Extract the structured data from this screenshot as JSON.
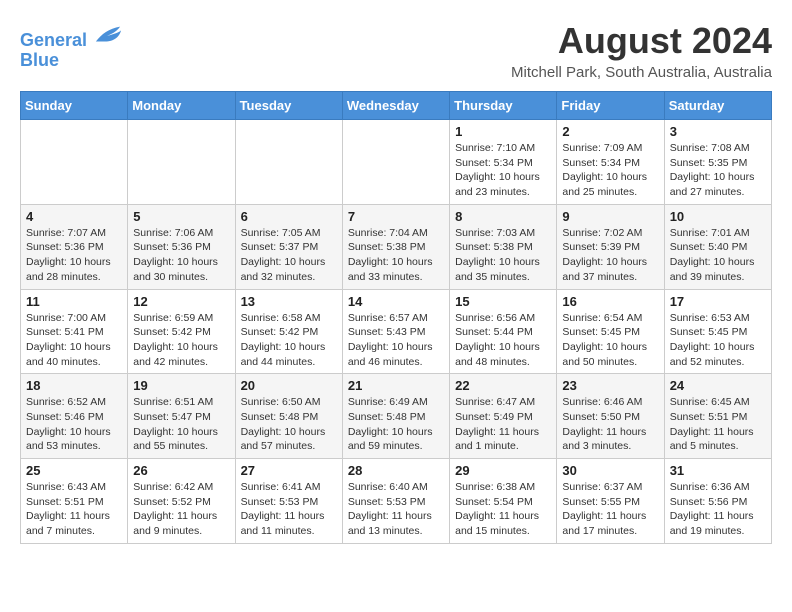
{
  "logo": {
    "line1": "General",
    "line2": "Blue"
  },
  "title": "August 2024",
  "subtitle": "Mitchell Park, South Australia, Australia",
  "days_of_week": [
    "Sunday",
    "Monday",
    "Tuesday",
    "Wednesday",
    "Thursday",
    "Friday",
    "Saturday"
  ],
  "weeks": [
    [
      {
        "day": "",
        "info": ""
      },
      {
        "day": "",
        "info": ""
      },
      {
        "day": "",
        "info": ""
      },
      {
        "day": "",
        "info": ""
      },
      {
        "day": "1",
        "info": "Sunrise: 7:10 AM\nSunset: 5:34 PM\nDaylight: 10 hours\nand 23 minutes."
      },
      {
        "day": "2",
        "info": "Sunrise: 7:09 AM\nSunset: 5:34 PM\nDaylight: 10 hours\nand 25 minutes."
      },
      {
        "day": "3",
        "info": "Sunrise: 7:08 AM\nSunset: 5:35 PM\nDaylight: 10 hours\nand 27 minutes."
      }
    ],
    [
      {
        "day": "4",
        "info": "Sunrise: 7:07 AM\nSunset: 5:36 PM\nDaylight: 10 hours\nand 28 minutes."
      },
      {
        "day": "5",
        "info": "Sunrise: 7:06 AM\nSunset: 5:36 PM\nDaylight: 10 hours\nand 30 minutes."
      },
      {
        "day": "6",
        "info": "Sunrise: 7:05 AM\nSunset: 5:37 PM\nDaylight: 10 hours\nand 32 minutes."
      },
      {
        "day": "7",
        "info": "Sunrise: 7:04 AM\nSunset: 5:38 PM\nDaylight: 10 hours\nand 33 minutes."
      },
      {
        "day": "8",
        "info": "Sunrise: 7:03 AM\nSunset: 5:38 PM\nDaylight: 10 hours\nand 35 minutes."
      },
      {
        "day": "9",
        "info": "Sunrise: 7:02 AM\nSunset: 5:39 PM\nDaylight: 10 hours\nand 37 minutes."
      },
      {
        "day": "10",
        "info": "Sunrise: 7:01 AM\nSunset: 5:40 PM\nDaylight: 10 hours\nand 39 minutes."
      }
    ],
    [
      {
        "day": "11",
        "info": "Sunrise: 7:00 AM\nSunset: 5:41 PM\nDaylight: 10 hours\nand 40 minutes."
      },
      {
        "day": "12",
        "info": "Sunrise: 6:59 AM\nSunset: 5:42 PM\nDaylight: 10 hours\nand 42 minutes."
      },
      {
        "day": "13",
        "info": "Sunrise: 6:58 AM\nSunset: 5:42 PM\nDaylight: 10 hours\nand 44 minutes."
      },
      {
        "day": "14",
        "info": "Sunrise: 6:57 AM\nSunset: 5:43 PM\nDaylight: 10 hours\nand 46 minutes."
      },
      {
        "day": "15",
        "info": "Sunrise: 6:56 AM\nSunset: 5:44 PM\nDaylight: 10 hours\nand 48 minutes."
      },
      {
        "day": "16",
        "info": "Sunrise: 6:54 AM\nSunset: 5:45 PM\nDaylight: 10 hours\nand 50 minutes."
      },
      {
        "day": "17",
        "info": "Sunrise: 6:53 AM\nSunset: 5:45 PM\nDaylight: 10 hours\nand 52 minutes."
      }
    ],
    [
      {
        "day": "18",
        "info": "Sunrise: 6:52 AM\nSunset: 5:46 PM\nDaylight: 10 hours\nand 53 minutes."
      },
      {
        "day": "19",
        "info": "Sunrise: 6:51 AM\nSunset: 5:47 PM\nDaylight: 10 hours\nand 55 minutes."
      },
      {
        "day": "20",
        "info": "Sunrise: 6:50 AM\nSunset: 5:48 PM\nDaylight: 10 hours\nand 57 minutes."
      },
      {
        "day": "21",
        "info": "Sunrise: 6:49 AM\nSunset: 5:48 PM\nDaylight: 10 hours\nand 59 minutes."
      },
      {
        "day": "22",
        "info": "Sunrise: 6:47 AM\nSunset: 5:49 PM\nDaylight: 11 hours\nand 1 minute."
      },
      {
        "day": "23",
        "info": "Sunrise: 6:46 AM\nSunset: 5:50 PM\nDaylight: 11 hours\nand 3 minutes."
      },
      {
        "day": "24",
        "info": "Sunrise: 6:45 AM\nSunset: 5:51 PM\nDaylight: 11 hours\nand 5 minutes."
      }
    ],
    [
      {
        "day": "25",
        "info": "Sunrise: 6:43 AM\nSunset: 5:51 PM\nDaylight: 11 hours\nand 7 minutes."
      },
      {
        "day": "26",
        "info": "Sunrise: 6:42 AM\nSunset: 5:52 PM\nDaylight: 11 hours\nand 9 minutes."
      },
      {
        "day": "27",
        "info": "Sunrise: 6:41 AM\nSunset: 5:53 PM\nDaylight: 11 hours\nand 11 minutes."
      },
      {
        "day": "28",
        "info": "Sunrise: 6:40 AM\nSunset: 5:53 PM\nDaylight: 11 hours\nand 13 minutes."
      },
      {
        "day": "29",
        "info": "Sunrise: 6:38 AM\nSunset: 5:54 PM\nDaylight: 11 hours\nand 15 minutes."
      },
      {
        "day": "30",
        "info": "Sunrise: 6:37 AM\nSunset: 5:55 PM\nDaylight: 11 hours\nand 17 minutes."
      },
      {
        "day": "31",
        "info": "Sunrise: 6:36 AM\nSunset: 5:56 PM\nDaylight: 11 hours\nand 19 minutes."
      }
    ]
  ]
}
